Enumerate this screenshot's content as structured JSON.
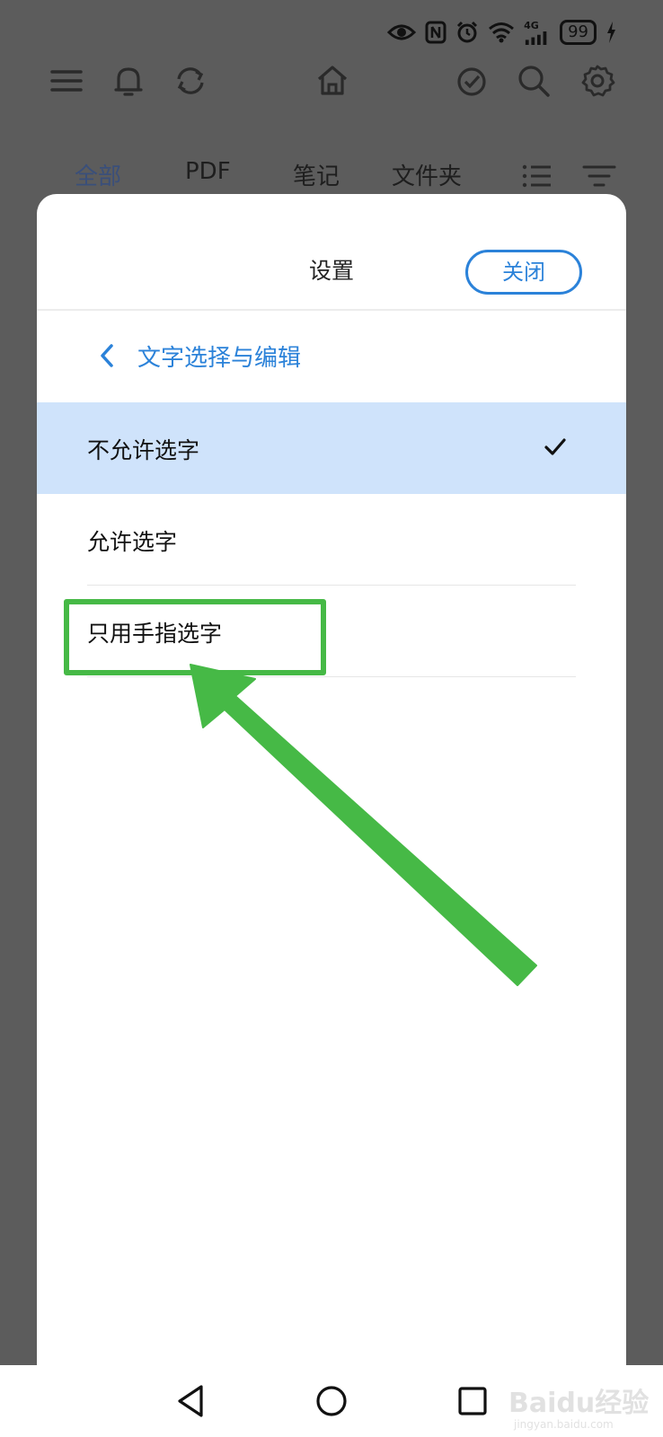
{
  "status_bar": {
    "battery": "99",
    "network": "4G",
    "icons": [
      "eye-icon",
      "nfc-icon",
      "alarm-icon",
      "wifi-icon",
      "signal-icon",
      "battery-icon",
      "charging-icon"
    ]
  },
  "toolbar": {
    "icons": [
      "menu-icon",
      "bell-icon",
      "sync-icon",
      "home-icon",
      "check-circle-icon",
      "search-icon",
      "gear-icon"
    ]
  },
  "filter_tabs": [
    "全部",
    "PDF",
    "笔记",
    "文件夹"
  ],
  "dialog": {
    "title": "设置",
    "close_label": "关闭",
    "subnav_title": "文字选择与编辑",
    "options": [
      {
        "label": "不允许选字",
        "selected": true
      },
      {
        "label": "允许选字",
        "selected": false
      },
      {
        "label": "只用手指选字",
        "selected": false
      }
    ]
  },
  "nav_bar": {
    "icons": [
      "back-icon",
      "home-circle-icon",
      "recents-icon"
    ]
  },
  "watermark": {
    "text": "Baidu 经验",
    "subtext": "jingyan.baidu.com"
  },
  "colors": {
    "accent": "#2b82d9",
    "selected_bg": "#cfe3fb",
    "annotation": "#46b946",
    "overlay": "#5c5c5c"
  }
}
